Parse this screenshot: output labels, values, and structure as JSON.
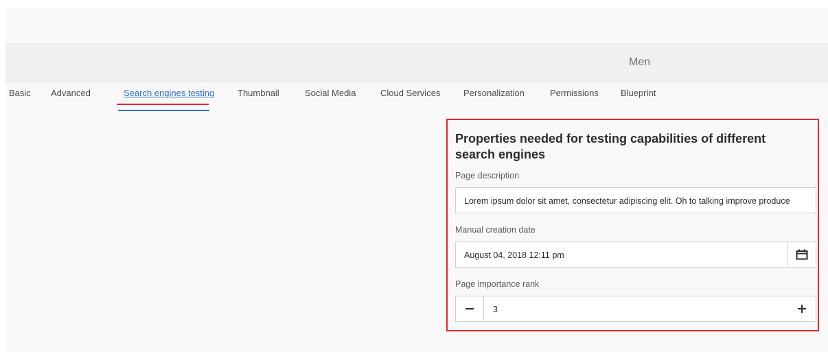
{
  "header": {
    "title": "Men"
  },
  "tabs": [
    {
      "label": "Basic",
      "active": false
    },
    {
      "label": "Advanced",
      "active": false
    },
    {
      "label": "Search engines testing",
      "active": true
    },
    {
      "label": "Thumbnail",
      "active": false
    },
    {
      "label": "Social Media",
      "active": false
    },
    {
      "label": "Cloud Services",
      "active": false
    },
    {
      "label": "Personalization",
      "active": false
    },
    {
      "label": "Permissions",
      "active": false
    },
    {
      "label": "Blueprint",
      "active": false
    }
  ],
  "panel": {
    "heading": "Properties needed for testing capabilities of different search engines",
    "page_description": {
      "label": "Page description",
      "value": "Lorem ipsum dolor sit amet, consectetur adipiscing elit. Oh to talking improve produce"
    },
    "creation_date": {
      "label": "Manual creation date",
      "value": "August 04, 2018 12:11 pm",
      "icon": "calendar-icon"
    },
    "importance_rank": {
      "label": "Page importance rank",
      "value": "3",
      "minus_icon": "minus-icon",
      "plus_icon": "plus-icon"
    }
  },
  "colors": {
    "accent": "#2c6fd3",
    "highlight": "#e3262c",
    "background": "#f8f8f8"
  }
}
